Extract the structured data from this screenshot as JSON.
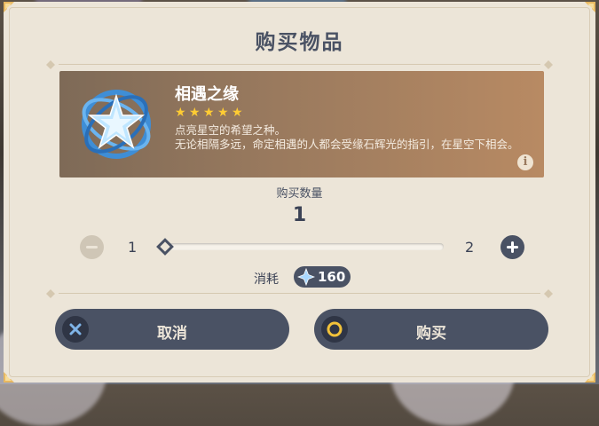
{
  "dialog": {
    "title": "购买物品"
  },
  "item": {
    "name": "相遇之缘",
    "rarity_stars": 5,
    "description": "点亮星空的希望之种。\n无论相隔多远，命定相遇的人都会受缘石辉光的指引，在星空下相会。",
    "icon": "intertwined-fate-icon"
  },
  "quantity": {
    "label": "购买数量",
    "value": "1",
    "min": "1",
    "max": "2",
    "slider_fraction": 0.0
  },
  "cost": {
    "label": "消耗",
    "amount": "160",
    "currency_icon": "starglitter-icon"
  },
  "buttons": {
    "cancel": "取消",
    "confirm": "购买"
  },
  "colors": {
    "panel": "#ece5d8",
    "accent_dark": "#4a5264",
    "star": "#ffcc33",
    "confirm_ring": "#f2c23a",
    "cancel_icon": "#7fb4e8"
  }
}
